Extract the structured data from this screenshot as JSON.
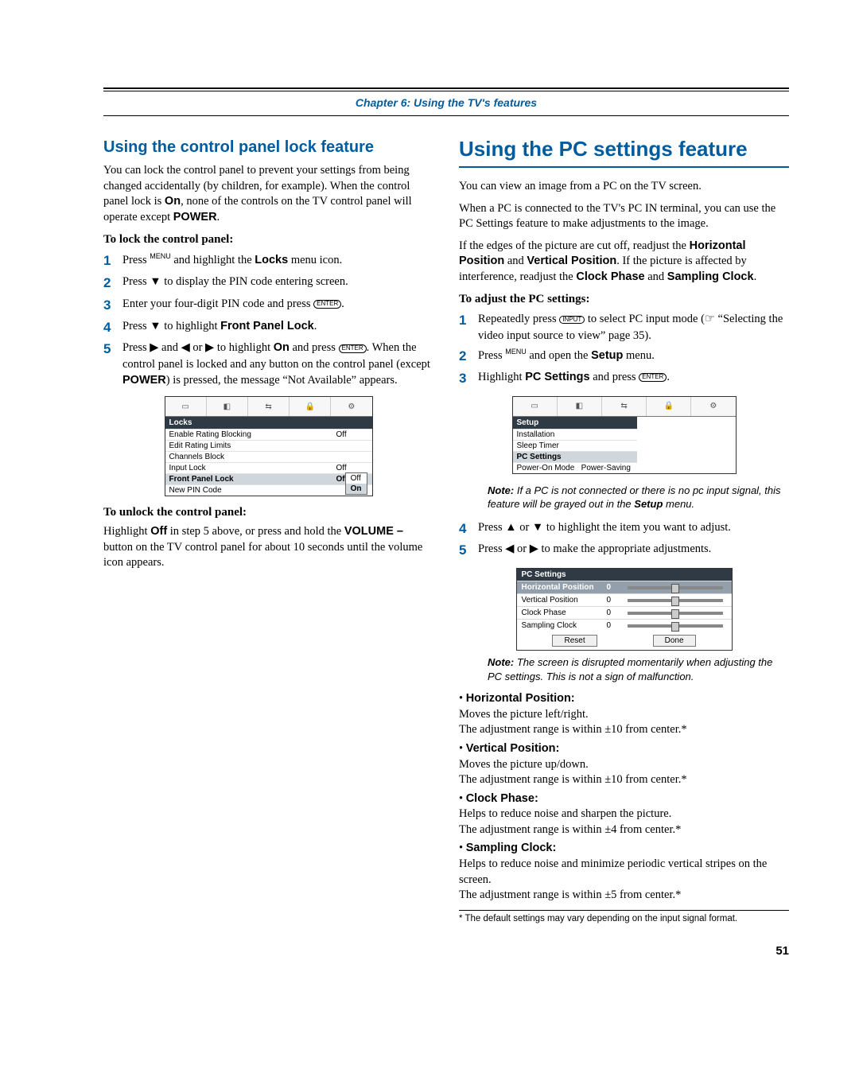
{
  "chapter_line": "Chapter 6: Using the TV's features",
  "left": {
    "h2": "Using the control panel lock feature",
    "intro": "You can lock the control panel to prevent your settings from being changed accidentally (by children, for example). When the control panel lock is On, none of the controls on the TV control panel will operate except POWER.",
    "intro_bold1": "On",
    "intro_bold2": "POWER",
    "sub1": "To lock the control panel:",
    "step1": "Press MENU and highlight the Locks menu icon.",
    "step1_bold": "Locks",
    "step2": "Press ▼ to display the PIN code entering screen.",
    "step3": "Enter your four-digit PIN code and press ENTER.",
    "step4": "Press ▼ to highlight Front Panel Lock.",
    "step4_bold": "Front Panel Lock",
    "step5": "Press ▶ and ◀ or ▶ to highlight On and press ENTER. When the control panel is locked and any button on the control panel (except POWER) is pressed, the message \"Not Available\" appears.",
    "step5_boldA": "On",
    "step5_boldB": "POWER",
    "mock": {
      "header": "Locks",
      "rows": [
        {
          "label": "Enable Rating Blocking",
          "val": "Off"
        },
        {
          "label": "Edit Rating Limits",
          "val": ""
        },
        {
          "label": "Channels Block",
          "val": ""
        },
        {
          "label": "Input Lock",
          "val": "Off"
        },
        {
          "label": "Front Panel Lock",
          "val": "Off",
          "sel": true
        },
        {
          "label": "New PIN Code",
          "val": ""
        }
      ],
      "popup": [
        "Off",
        "On"
      ]
    },
    "sub2": "To unlock the control panel:",
    "unlock": "Highlight Off in step 5 above, or press and hold the VOLUME – button on the TV control panel for about 10 seconds until the volume icon appears.",
    "unlock_bold1": "Off",
    "unlock_bold2": "VOLUME –"
  },
  "right": {
    "h1": "Using the PC settings feature",
    "p1": "You can view an image from a PC on the TV screen.",
    "p2": "When a PC is connected to the TV's PC IN terminal, you can use the PC Settings feature to make adjustments to the image.",
    "p3_a": "If the edges of the picture are cut off, readjust the ",
    "p3_b1": "Horizontal Position",
    "p3_mid": " and ",
    "p3_b2": "Vertical Position",
    "p3_c": ". If the picture is affected by interference, readjust the ",
    "p3_b3": "Clock Phase",
    "p3_and": " and ",
    "p3_b4": "Sampling Clock",
    "p3_end": ".",
    "sub1": "To adjust the PC settings:",
    "step1": "Repeatedly press INPUT to select PC input mode (☞ \"Selecting the video input source to view\" page 35).",
    "step2": "Press MENU and open the Setup menu.",
    "step2_bold": "Setup",
    "step3": "Highlight PC Settings and press ENTER.",
    "step3_bold": "PC Settings",
    "mockA": {
      "header": "Setup",
      "rows": [
        {
          "label": "Installation"
        },
        {
          "label": "Sleep Timer"
        },
        {
          "label": "PC Settings",
          "sel": true
        },
        {
          "label": "Power-On Mode",
          "val": "Power-Saving"
        }
      ]
    },
    "note1_b": "Note:",
    "note1": " If a PC is not connected or there is no pc input signal, this feature will be grayed out in the Setup menu.",
    "note1_bold": "Setup",
    "step4": "Press ▲ or ▼ to highlight the item you want to adjust.",
    "step5": "Press ◀ or ▶ to make the appropriate adjustments.",
    "mockB": {
      "header": "PC Settings",
      "rows": [
        {
          "label": "Horizontal Position",
          "val": "0",
          "sel": true
        },
        {
          "label": "Vertical Position",
          "val": "0"
        },
        {
          "label": "Clock Phase",
          "val": "0"
        },
        {
          "label": "Sampling Clock",
          "val": "0"
        }
      ],
      "btns": [
        "Reset",
        "Done"
      ]
    },
    "note2_b": "Note:",
    "note2": " The screen is disrupted momentarily when adjusting the PC settings. This is not a sign of malfunction.",
    "bullets": [
      {
        "name": "Horizontal Position:",
        "l1": "Moves the picture left/right.",
        "l2": "The adjustment range is within ±10 from center.*"
      },
      {
        "name": "Vertical Position:",
        "l1": "Moves the picture up/down.",
        "l2": "The adjustment range is within ±10 from center.*"
      },
      {
        "name": "Clock Phase:",
        "l1": "Helps to reduce noise and sharpen the picture.",
        "l2": "The adjustment range is within ±4 from center.*"
      },
      {
        "name": "Sampling Clock:",
        "l1": "Helps to reduce noise and minimize periodic vertical stripes on the screen.",
        "l2": "The adjustment range is within ±5 from center.*"
      }
    ],
    "footnote": "*  The default settings may vary depending on the input signal format."
  },
  "pagenum": "51"
}
